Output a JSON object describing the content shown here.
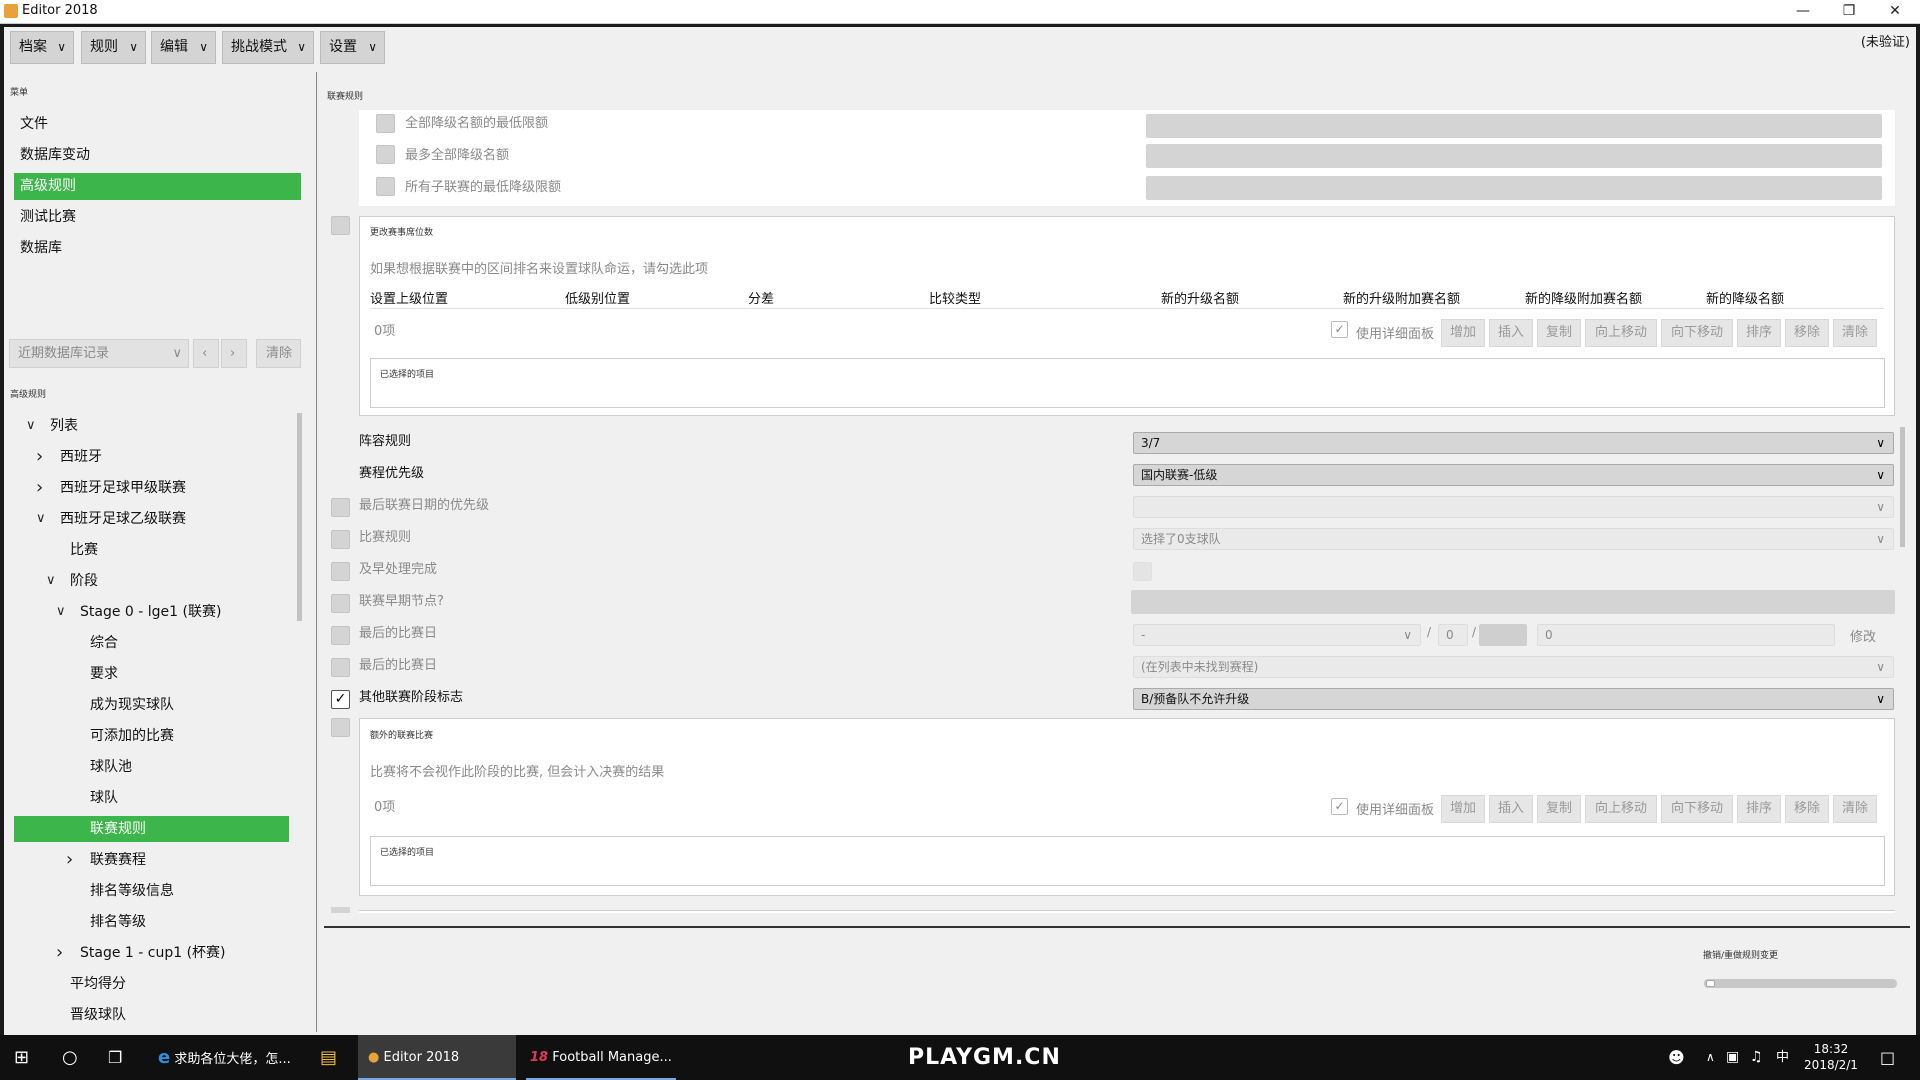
{
  "window": {
    "title": "Editor 2018"
  },
  "menu": [
    {
      "label": "档案"
    },
    {
      "label": "规则"
    },
    {
      "label": "编辑"
    },
    {
      "label": "挑战模式"
    },
    {
      "label": "设置"
    }
  ],
  "status_unverified": "(未验证)",
  "sidebar": {
    "menu_header": "菜单",
    "items": [
      "文件",
      "数据库变动",
      "高级规则",
      "测试比赛",
      "数据库"
    ],
    "selected_index": 2,
    "recent_placeholder": "近期数据库记录",
    "clear_label": "清除",
    "tree_header": "高级规则",
    "tree": [
      {
        "label": "列表",
        "level": 0,
        "arrow": "down"
      },
      {
        "label": "西班牙",
        "level": 1,
        "arrow": "right"
      },
      {
        "label": "西班牙足球甲级联赛",
        "level": 1,
        "arrow": "right"
      },
      {
        "label": "西班牙足球乙级联赛",
        "level": 1,
        "arrow": "down"
      },
      {
        "label": "比赛",
        "level": 2,
        "arrow": ""
      },
      {
        "label": "阶段",
        "level": 2,
        "arrow": "down"
      },
      {
        "label": "Stage 0 - lge1 (联赛)",
        "level": 3,
        "arrow": "down"
      },
      {
        "label": "综合",
        "level": 4,
        "arrow": ""
      },
      {
        "label": "要求",
        "level": 4,
        "arrow": ""
      },
      {
        "label": "成为现实球队",
        "level": 4,
        "arrow": ""
      },
      {
        "label": "可添加的比赛",
        "level": 4,
        "arrow": ""
      },
      {
        "label": "球队池",
        "level": 4,
        "arrow": ""
      },
      {
        "label": "球队",
        "level": 4,
        "arrow": ""
      },
      {
        "label": "联赛规则",
        "level": 4,
        "arrow": "",
        "selected": true
      },
      {
        "label": "联赛赛程",
        "level": 4,
        "arrow": "right"
      },
      {
        "label": "排名等级信息",
        "level": 4,
        "arrow": ""
      },
      {
        "label": "排名等级",
        "level": 4,
        "arrow": ""
      },
      {
        "label": "Stage 1 - cup1 (杯赛)",
        "level": 3,
        "arrow": "right"
      },
      {
        "label": "平均得分",
        "level": 2,
        "arrow": ""
      },
      {
        "label": "晋级球队",
        "level": 2,
        "arrow": ""
      }
    ]
  },
  "main": {
    "header": "联赛规则",
    "top_rows": [
      "全部降级名额的最低限额",
      "最多全部降级名额",
      "所有子联赛的最低降级限额"
    ],
    "section1": {
      "title": "更改赛事席位数",
      "hint": "如果想根据联赛中的区间排名来设置球队命运，请勾选此项",
      "columns": [
        "设置上级位置",
        "低级别位置",
        "分差",
        "比较类型",
        "新的升级名额",
        "新的升级附加赛名额",
        "新的降级附加赛名额",
        "新的降级名额"
      ],
      "count": "0项",
      "use_detail": "使用详细面板",
      "buttons": [
        "增加",
        "插入",
        "复制",
        "向上移动",
        "向下移动",
        "排序",
        "移除",
        "清除"
      ],
      "selected_label": "已选择的项目"
    },
    "rules": [
      {
        "label": "阵容规则",
        "value": "3/7",
        "enabled": true
      },
      {
        "label": "赛程优先级",
        "value": "国内联赛-低级",
        "enabled": true
      },
      {
        "label": "最后联赛日期的优先级",
        "value": "",
        "enabled": false
      },
      {
        "label": "比赛规则",
        "value": "选择了0支球队",
        "enabled": false
      },
      {
        "label": "及早处理完成",
        "value": "",
        "enabled": false
      },
      {
        "label": "联赛早期节点?",
        "value": "",
        "enabled": false
      },
      {
        "label": "最后的比赛日",
        "value": "-",
        "value2": "0",
        "value3": "0",
        "edit": "修改",
        "enabled": false
      },
      {
        "label": "最后的比赛日",
        "value": "(在列表中未找到赛程)",
        "enabled": false
      },
      {
        "label": "其他联赛阶段标志",
        "value": "B/预备队不允许升级",
        "enabled": true,
        "checked": true
      }
    ],
    "section2": {
      "title": "额外的联赛比赛",
      "hint": "比赛将不会视作此阶段的比赛, 但会计入决赛的结果",
      "count": "0项",
      "use_detail": "使用详细面板",
      "buttons": [
        "增加",
        "插入",
        "复制",
        "向上移动",
        "向下移动",
        "排序",
        "移除",
        "清除"
      ],
      "selected_label": "已选择的项目"
    },
    "undo_label": "撤销/重做规则变更"
  },
  "taskbar": {
    "items": [
      "求助各位大佬，怎...",
      "Editor 2018",
      "Football Manage..."
    ],
    "watermark": "PLAYGM.CN",
    "ime": "中",
    "time": "18:32",
    "date": "2018/2/1"
  },
  "colors": {
    "accent": "#3cb64b"
  }
}
